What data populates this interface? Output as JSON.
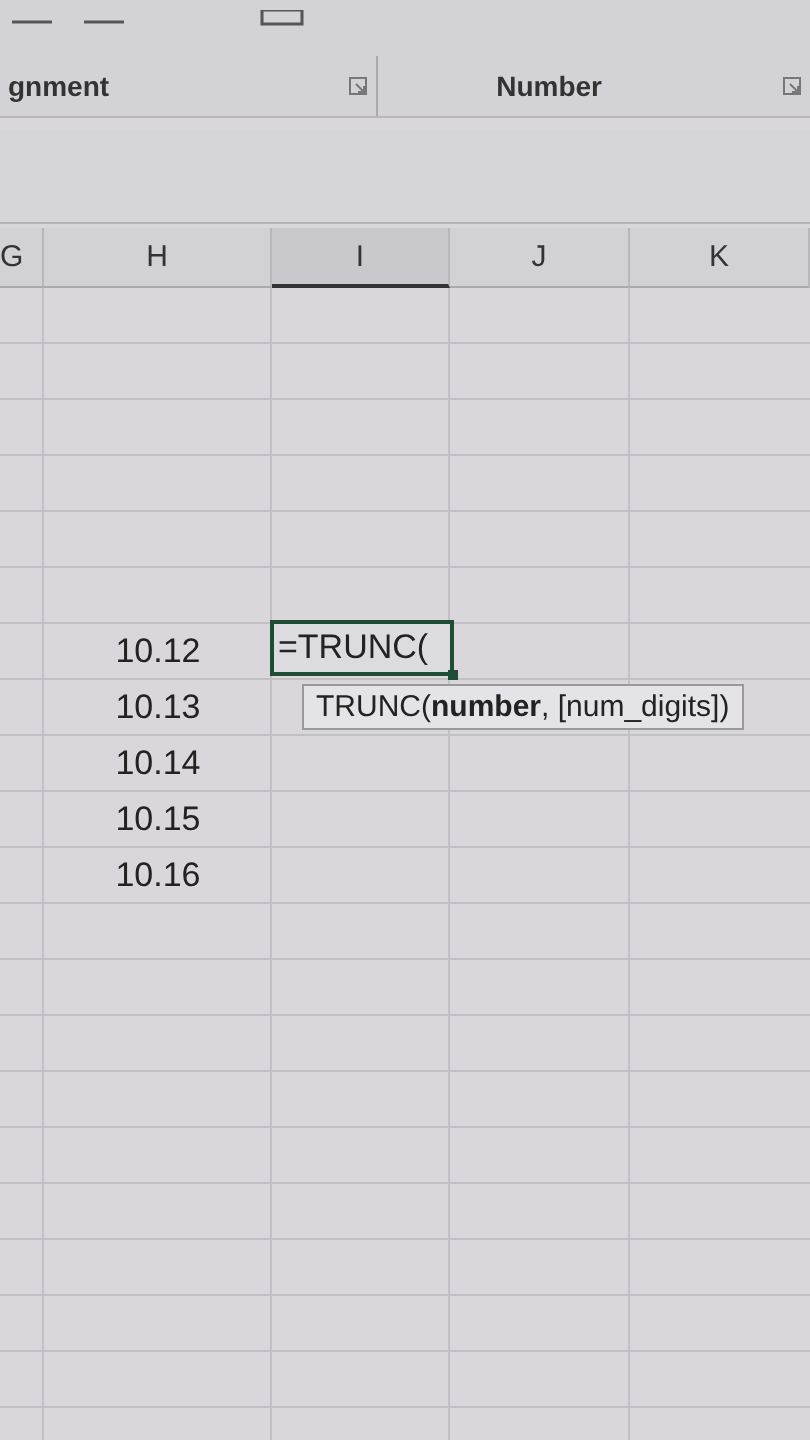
{
  "ribbon": {
    "groups": [
      {
        "label": "gnment"
      },
      {
        "label": "Number"
      }
    ]
  },
  "columns": [
    {
      "label": "G",
      "selected": false
    },
    {
      "label": "H",
      "selected": false
    },
    {
      "label": "I",
      "selected": true
    },
    {
      "label": "J",
      "selected": false
    },
    {
      "label": "K",
      "selected": false
    }
  ],
  "column_h_values": [
    "10.12",
    "10.13",
    "10.14",
    "10.15",
    "10.16"
  ],
  "active_cell": {
    "text": "=TRUNC(",
    "tooltip": "TRUNC(**number**, [num_digits])"
  }
}
